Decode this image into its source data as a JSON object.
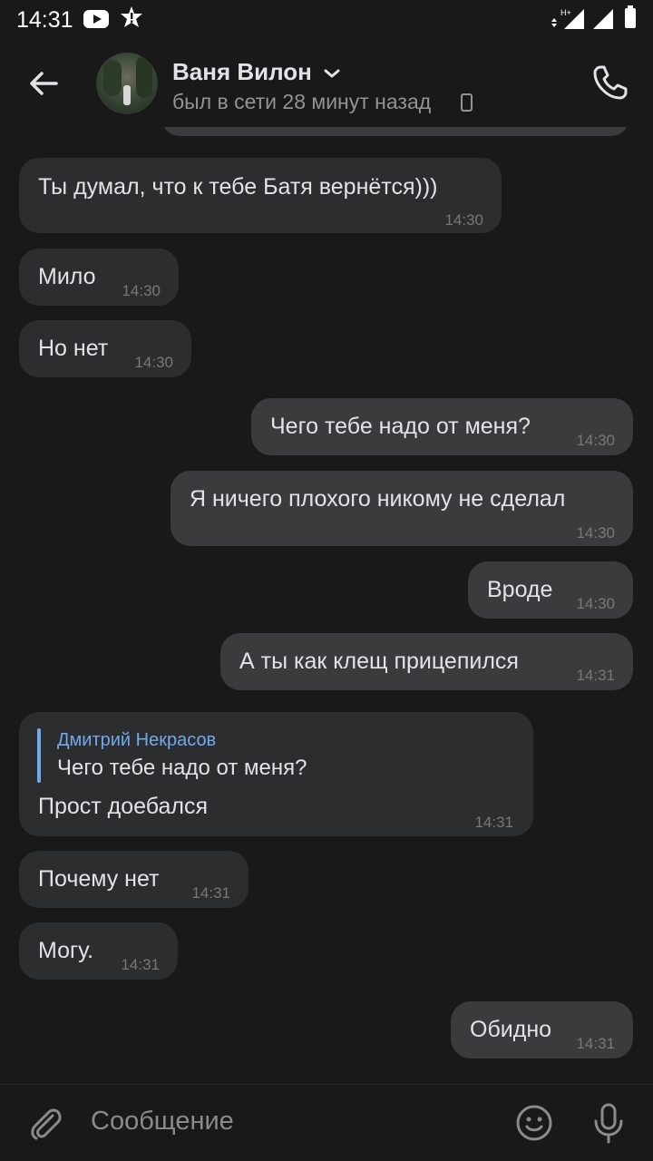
{
  "status_bar": {
    "time": "14:31",
    "network_label": "H+"
  },
  "header": {
    "contact_name": "Ваня Вилон",
    "last_seen": "был в сети 28 минут назад"
  },
  "messages": [
    {
      "direction": "in",
      "text": "Ты думал, что к тебе Батя вернётся)))",
      "time": "14:30"
    },
    {
      "direction": "in",
      "text": "Мило",
      "time": "14:30"
    },
    {
      "direction": "in",
      "text": "Но нет",
      "time": "14:30"
    },
    {
      "direction": "out",
      "text": "Чего тебе надо от меня?",
      "time": "14:30"
    },
    {
      "direction": "out",
      "text": "Я ничего плохого никому не сделал",
      "time": "14:30"
    },
    {
      "direction": "out",
      "text": "Вроде",
      "time": "14:30"
    },
    {
      "direction": "out",
      "text": "А ты как клещ прицепился",
      "time": "14:31"
    },
    {
      "direction": "in",
      "reply_author": "Дмитрий Некрасов",
      "reply_text": "Чего тебе надо от меня?",
      "text": "Прост доебался",
      "time": "14:31"
    },
    {
      "direction": "in",
      "text": "Почему нет",
      "time": "14:31"
    },
    {
      "direction": "in",
      "text": "Могу.",
      "time": "14:31"
    },
    {
      "direction": "out",
      "text": "Обидно",
      "time": "14:31"
    }
  ],
  "composer": {
    "placeholder": "Сообщение"
  },
  "colors": {
    "background": "#19191a",
    "incoming_bubble": "#2c2d2e",
    "outgoing_bubble": "#3b3b3d",
    "accent": "#71aaeb",
    "text": "#e1e3e6",
    "secondary_text": "#939393"
  },
  "icons": {
    "back": "arrow-left-icon",
    "phone": "phone-icon",
    "attach": "paperclip-icon",
    "emoji": "smile-icon",
    "mic": "microphone-icon",
    "device": "mobile-phone-icon",
    "chevron": "chevron-down-icon"
  }
}
